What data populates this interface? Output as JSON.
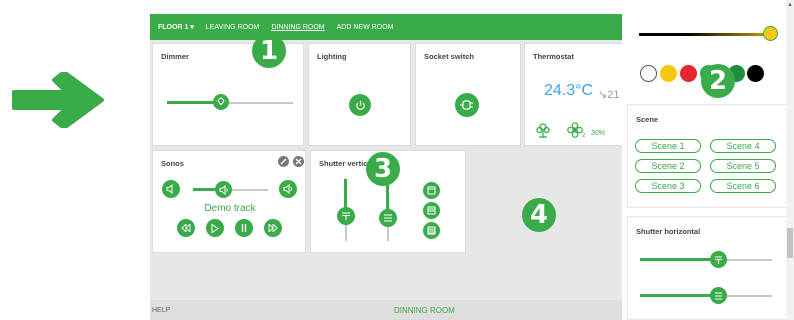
{
  "nav": {
    "floor": "FLOOR 1 ▾",
    "items": [
      "LEAVING ROOM",
      "DINNING ROOM",
      "ADD NEW ROOM"
    ]
  },
  "callouts": [
    "1",
    "2",
    "3",
    "4"
  ],
  "cards": {
    "dimmer": {
      "title": "Dimmer",
      "level": 0.35
    },
    "lighting": {
      "title": "Lighting"
    },
    "socket": {
      "title": "Socket switch"
    },
    "thermostat": {
      "title": "Thermostat",
      "temperature": "24.3°C",
      "target": "↘21",
      "fan_speed": "2",
      "humidity": "30%"
    },
    "sonos": {
      "title": "Sonos",
      "track": "Demo track",
      "volume": 0.45
    },
    "shutter_vertical": {
      "title": "Shutter vertical"
    }
  },
  "right_panel": {
    "colors": [
      "#ffffff",
      "#f6c80e",
      "#e8262b",
      "#2bb24c",
      "#1f8f3f",
      "#000000"
    ],
    "scene": {
      "title": "Scene",
      "buttons": [
        "Scene 1",
        "Scene 4",
        "Scene 2",
        "Scene 5",
        "Scene 3",
        "Scene 6"
      ]
    },
    "shutter_horizontal": {
      "title": "Shutter horizontal"
    }
  },
  "footer": {
    "help": "HELP",
    "room": "DINNING ROOM"
  },
  "colors": {
    "accent": "#3aab49",
    "temperature": "#3da3dc"
  }
}
